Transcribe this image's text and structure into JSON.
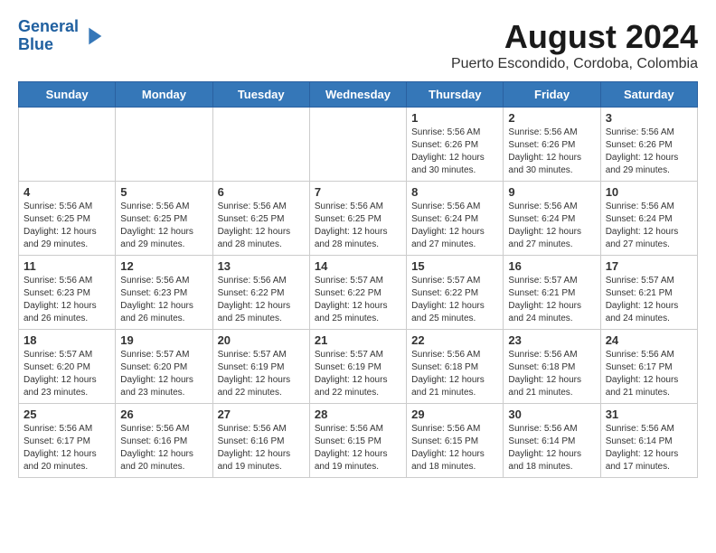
{
  "header": {
    "logo_line1": "General",
    "logo_line2": "Blue",
    "title": "August 2024",
    "subtitle": "Puerto Escondido, Cordoba, Colombia"
  },
  "days_of_week": [
    "Sunday",
    "Monday",
    "Tuesday",
    "Wednesday",
    "Thursday",
    "Friday",
    "Saturday"
  ],
  "weeks": [
    [
      {
        "day": "",
        "info": ""
      },
      {
        "day": "",
        "info": ""
      },
      {
        "day": "",
        "info": ""
      },
      {
        "day": "",
        "info": ""
      },
      {
        "day": "1",
        "info": "Sunrise: 5:56 AM\nSunset: 6:26 PM\nDaylight: 12 hours\nand 30 minutes."
      },
      {
        "day": "2",
        "info": "Sunrise: 5:56 AM\nSunset: 6:26 PM\nDaylight: 12 hours\nand 30 minutes."
      },
      {
        "day": "3",
        "info": "Sunrise: 5:56 AM\nSunset: 6:26 PM\nDaylight: 12 hours\nand 29 minutes."
      }
    ],
    [
      {
        "day": "4",
        "info": "Sunrise: 5:56 AM\nSunset: 6:25 PM\nDaylight: 12 hours\nand 29 minutes."
      },
      {
        "day": "5",
        "info": "Sunrise: 5:56 AM\nSunset: 6:25 PM\nDaylight: 12 hours\nand 29 minutes."
      },
      {
        "day": "6",
        "info": "Sunrise: 5:56 AM\nSunset: 6:25 PM\nDaylight: 12 hours\nand 28 minutes."
      },
      {
        "day": "7",
        "info": "Sunrise: 5:56 AM\nSunset: 6:25 PM\nDaylight: 12 hours\nand 28 minutes."
      },
      {
        "day": "8",
        "info": "Sunrise: 5:56 AM\nSunset: 6:24 PM\nDaylight: 12 hours\nand 27 minutes."
      },
      {
        "day": "9",
        "info": "Sunrise: 5:56 AM\nSunset: 6:24 PM\nDaylight: 12 hours\nand 27 minutes."
      },
      {
        "day": "10",
        "info": "Sunrise: 5:56 AM\nSunset: 6:24 PM\nDaylight: 12 hours\nand 27 minutes."
      }
    ],
    [
      {
        "day": "11",
        "info": "Sunrise: 5:56 AM\nSunset: 6:23 PM\nDaylight: 12 hours\nand 26 minutes."
      },
      {
        "day": "12",
        "info": "Sunrise: 5:56 AM\nSunset: 6:23 PM\nDaylight: 12 hours\nand 26 minutes."
      },
      {
        "day": "13",
        "info": "Sunrise: 5:56 AM\nSunset: 6:22 PM\nDaylight: 12 hours\nand 25 minutes."
      },
      {
        "day": "14",
        "info": "Sunrise: 5:57 AM\nSunset: 6:22 PM\nDaylight: 12 hours\nand 25 minutes."
      },
      {
        "day": "15",
        "info": "Sunrise: 5:57 AM\nSunset: 6:22 PM\nDaylight: 12 hours\nand 25 minutes."
      },
      {
        "day": "16",
        "info": "Sunrise: 5:57 AM\nSunset: 6:21 PM\nDaylight: 12 hours\nand 24 minutes."
      },
      {
        "day": "17",
        "info": "Sunrise: 5:57 AM\nSunset: 6:21 PM\nDaylight: 12 hours\nand 24 minutes."
      }
    ],
    [
      {
        "day": "18",
        "info": "Sunrise: 5:57 AM\nSunset: 6:20 PM\nDaylight: 12 hours\nand 23 minutes."
      },
      {
        "day": "19",
        "info": "Sunrise: 5:57 AM\nSunset: 6:20 PM\nDaylight: 12 hours\nand 23 minutes."
      },
      {
        "day": "20",
        "info": "Sunrise: 5:57 AM\nSunset: 6:19 PM\nDaylight: 12 hours\nand 22 minutes."
      },
      {
        "day": "21",
        "info": "Sunrise: 5:57 AM\nSunset: 6:19 PM\nDaylight: 12 hours\nand 22 minutes."
      },
      {
        "day": "22",
        "info": "Sunrise: 5:56 AM\nSunset: 6:18 PM\nDaylight: 12 hours\nand 21 minutes."
      },
      {
        "day": "23",
        "info": "Sunrise: 5:56 AM\nSunset: 6:18 PM\nDaylight: 12 hours\nand 21 minutes."
      },
      {
        "day": "24",
        "info": "Sunrise: 5:56 AM\nSunset: 6:17 PM\nDaylight: 12 hours\nand 21 minutes."
      }
    ],
    [
      {
        "day": "25",
        "info": "Sunrise: 5:56 AM\nSunset: 6:17 PM\nDaylight: 12 hours\nand 20 minutes."
      },
      {
        "day": "26",
        "info": "Sunrise: 5:56 AM\nSunset: 6:16 PM\nDaylight: 12 hours\nand 20 minutes."
      },
      {
        "day": "27",
        "info": "Sunrise: 5:56 AM\nSunset: 6:16 PM\nDaylight: 12 hours\nand 19 minutes."
      },
      {
        "day": "28",
        "info": "Sunrise: 5:56 AM\nSunset: 6:15 PM\nDaylight: 12 hours\nand 19 minutes."
      },
      {
        "day": "29",
        "info": "Sunrise: 5:56 AM\nSunset: 6:15 PM\nDaylight: 12 hours\nand 18 minutes."
      },
      {
        "day": "30",
        "info": "Sunrise: 5:56 AM\nSunset: 6:14 PM\nDaylight: 12 hours\nand 18 minutes."
      },
      {
        "day": "31",
        "info": "Sunrise: 5:56 AM\nSunset: 6:14 PM\nDaylight: 12 hours\nand 17 minutes."
      }
    ]
  ]
}
